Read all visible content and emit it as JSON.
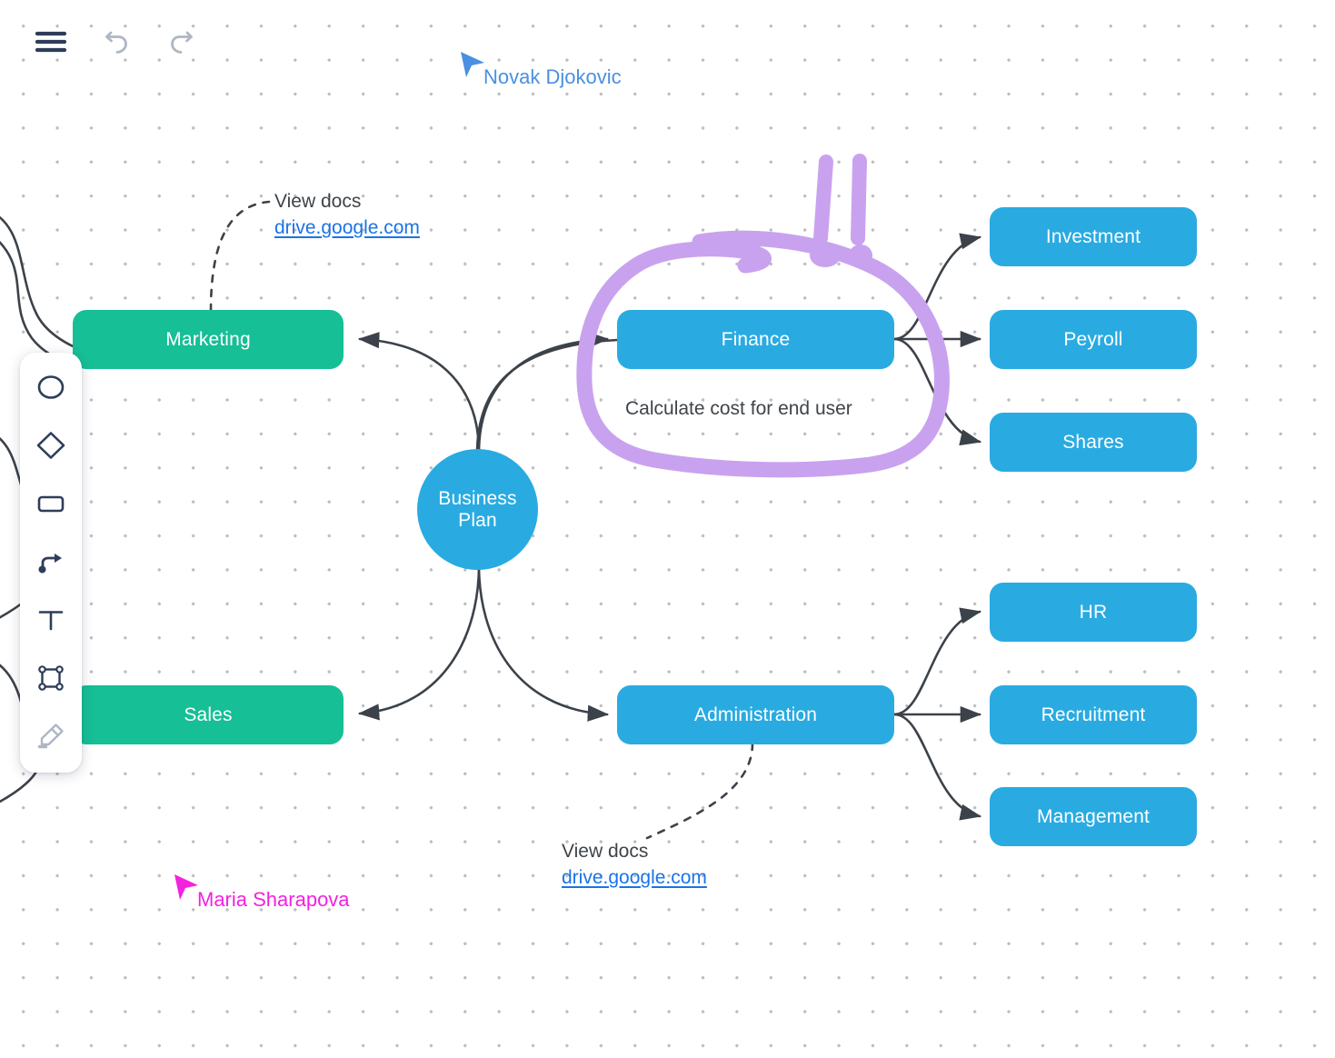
{
  "toolbar": {
    "menu_label": "Menu",
    "undo_label": "Undo",
    "redo_label": "Redo",
    "icons": [
      "hamburger-icon",
      "undo-icon",
      "redo-icon"
    ]
  },
  "tool_panel": {
    "tools": [
      {
        "id": "ellipse",
        "icon": "circle-icon",
        "label": "Ellipse",
        "active": false
      },
      {
        "id": "diamond",
        "icon": "diamond-icon",
        "label": "Diamond",
        "active": false
      },
      {
        "id": "rectangle",
        "icon": "rounded-rectangle-icon",
        "label": "Rectangle",
        "active": false
      },
      {
        "id": "connector",
        "icon": "connector-arrow-icon",
        "label": "Connector",
        "active": false
      },
      {
        "id": "text",
        "icon": "text-t-icon",
        "label": "Text",
        "active": false
      },
      {
        "id": "frame",
        "icon": "frame-icon",
        "label": "Frame",
        "active": false
      },
      {
        "id": "highlighter",
        "icon": "highlighter-pen-icon",
        "label": "Highlighter",
        "active": false,
        "disabled": true
      }
    ]
  },
  "colors": {
    "node_blue": "#29abe2",
    "node_green": "#16bf96",
    "annotation_purple": "#c9a2ef",
    "link_blue": "#1a73e8",
    "connector_gray": "#3c4249",
    "dot_grid": "#bcbdc1",
    "cursor_blue": "#4a90e2",
    "cursor_pink": "#f321e0",
    "icon_navy": "#2e3d59",
    "icon_muted": "#aeb6c4"
  },
  "nodes": [
    {
      "id": "marketing",
      "label": "Marketing",
      "shape": "rect",
      "color": "green"
    },
    {
      "id": "sales",
      "label": "Sales",
      "shape": "rect",
      "color": "green"
    },
    {
      "id": "business-plan",
      "label": "Business\nPlan",
      "shape": "circle",
      "color": "blue"
    },
    {
      "id": "finance",
      "label": "Finance",
      "shape": "rect",
      "color": "blue"
    },
    {
      "id": "administration",
      "label": "Administration",
      "shape": "rect",
      "color": "blue"
    },
    {
      "id": "investment",
      "label": "Investment",
      "shape": "rect",
      "color": "blue"
    },
    {
      "id": "peyroll",
      "label": "Peyroll",
      "shape": "rect",
      "color": "blue"
    },
    {
      "id": "shares",
      "label": "Shares",
      "shape": "rect",
      "color": "blue"
    },
    {
      "id": "hr",
      "label": "HR",
      "shape": "rect",
      "color": "blue"
    },
    {
      "id": "recruitment",
      "label": "Recruitment",
      "shape": "rect",
      "color": "blue"
    },
    {
      "id": "management",
      "label": "Management",
      "shape": "rect",
      "color": "blue"
    }
  ],
  "node_labels": {
    "marketing": "Marketing",
    "sales": "Sales",
    "business_plan_line1": "Business",
    "business_plan_line2": "Plan",
    "finance": "Finance",
    "administration": "Administration",
    "investment": "Investment",
    "peyroll": "Peyroll",
    "shares": "Shares",
    "hr": "HR",
    "recruitment": "Recruitment",
    "management": "Management"
  },
  "annotations": {
    "finance_note": "Calculate cost for end user",
    "marketing_doc": {
      "title": "View docs",
      "link": "drive.google.com"
    },
    "admin_doc": {
      "title": "View docs",
      "link": "drive.google.com"
    },
    "highlight_shape": "hand-drawn-lasso-with-double-exclamation"
  },
  "cursors": [
    {
      "id": "novak",
      "name": "Novak Djokovic",
      "color": "#4a90e2"
    },
    {
      "id": "maria",
      "name": "Maria Sharapova",
      "color": "#f321e0"
    }
  ]
}
